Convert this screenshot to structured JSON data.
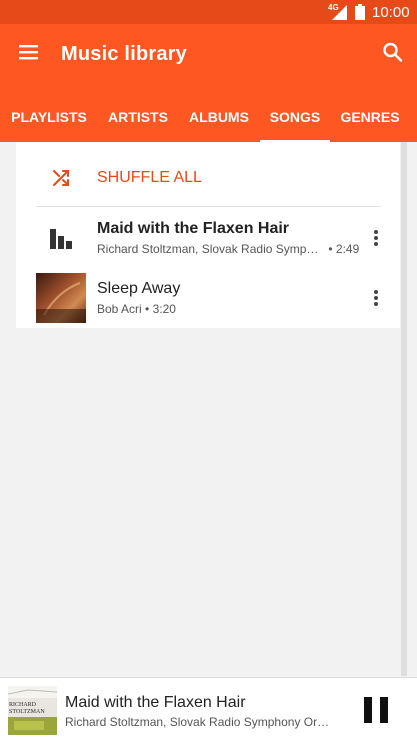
{
  "status_bar": {
    "network": "4G",
    "time": "10:00"
  },
  "app_bar": {
    "title": "Music library",
    "menu_icon": "menu-icon",
    "search_icon": "search-icon",
    "color": "#ff5722"
  },
  "tabs": [
    {
      "label": "PLAYLISTS",
      "active": false
    },
    {
      "label": "ARTISTS",
      "active": false
    },
    {
      "label": "ALBUMS",
      "active": false
    },
    {
      "label": "SONGS",
      "active": true
    },
    {
      "label": "GENRES",
      "active": false
    }
  ],
  "shuffle": {
    "label": "SHUFFLE ALL",
    "icon": "shuffle-icon",
    "color": "#e64a19"
  },
  "songs": [
    {
      "title": "Maid with the Flaxen Hair",
      "artist": "Richard Stoltzman, Slovak Radio Symphony Orchestra",
      "duration": "2:49",
      "separator": "•",
      "playing": true,
      "icon": "now-playing-icon"
    },
    {
      "title": "Sleep Away",
      "artist": "Bob Acri",
      "duration": "3:20",
      "separator": "•",
      "playing": false,
      "icon": "album-art"
    }
  ],
  "now_playing": {
    "title": "Maid with the Flaxen Hair",
    "subtitle": "Richard Stoltzman, Slovak Radio Symphony Orchestra",
    "art_text_1": "RICHARD",
    "art_text_2": "STOLTZMAN",
    "control_icon": "pause-icon"
  }
}
